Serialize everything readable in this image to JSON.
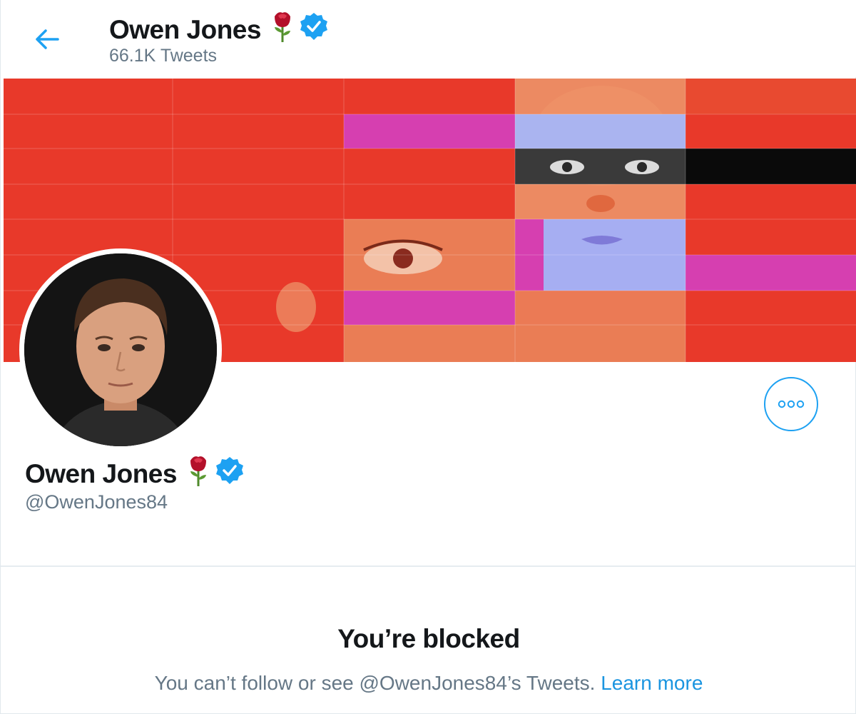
{
  "header": {
    "name": "Owen Jones",
    "tweet_count": "66.1K Tweets"
  },
  "profile": {
    "name": "Owen Jones",
    "handle": "@OwenJones84"
  },
  "blocked": {
    "title": "You’re blocked",
    "message": "You can’t follow or see @OwenJones84’s Tweets.",
    "link_label": "Learn more"
  },
  "icons": {
    "back": "arrow-left-icon",
    "rose": "rose-emoji-icon",
    "verified": "verified-badge-icon",
    "more": "more-horizontal-icon"
  },
  "colors": {
    "accent": "#1da1f2",
    "link": "#1b95e0",
    "banner_red": "#e8392a",
    "banner_pink": "#d63fb0",
    "secondary_text": "#657786"
  }
}
